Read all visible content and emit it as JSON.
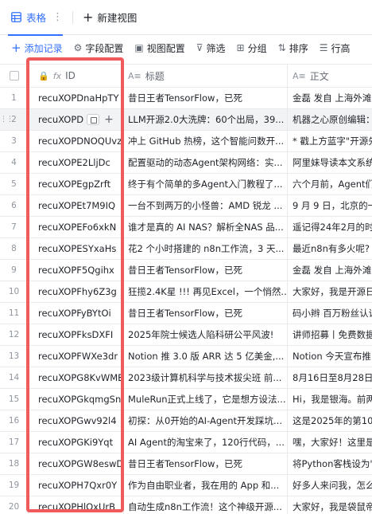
{
  "tabs": {
    "active_label": "表格",
    "more_glyph": "⋮",
    "new_view_label": "新建视图"
  },
  "toolbar": {
    "add_record": "添加记录",
    "field_config": "字段配置",
    "view_config": "视图配置",
    "filter": "筛选",
    "group": "分组",
    "sort": "排序",
    "row_height": "行高"
  },
  "columns": {
    "id": "ID",
    "title": "标题",
    "body": "正文"
  },
  "icons": {
    "table": "table-grid-icon",
    "lock": "lock-icon",
    "formula": "formula-icon",
    "text": "text-field-icon"
  },
  "colors": {
    "accent": "#3370ff",
    "highlight": "#f05a5a"
  },
  "rows": [
    {
      "num": "1",
      "id": "recuXOPDnaHpTY",
      "title": "昔日王者TensorFlow，已死",
      "body": "金磊 发自 上海外滩"
    },
    {
      "num": "2",
      "id": "recuXOPD",
      "title": "LLM开源2.0大洗牌：60个出局，39...",
      "body": "机器之心原创编辑："
    },
    {
      "num": "3",
      "id": "recuXOPDNOQUvz",
      "title": "冲上 GitHub 热榜，这个智能问数开...",
      "body": "* 戳上方蓝字\"开源先"
    },
    {
      "num": "4",
      "id": "recuXOPE2LljDc",
      "title": "配置驱动的动态Agent架构网络：实...",
      "body": "阿里妹导读本文系统"
    },
    {
      "num": "5",
      "id": "recuXOPEgpZrft",
      "title": "终于有个简单的多Agent入门教程了...",
      "body": "六个月前，Agent们"
    },
    {
      "num": "6",
      "id": "recuXOPEt7M9IQ",
      "title": "一台不到两万的小怪兽：AMD 锐龙 ...",
      "body": "9 月 9 日，北京的一"
    },
    {
      "num": "7",
      "id": "recuXOPEFo6xkN",
      "title": "谁才是真的 AI NAS？解析全NAS 品...",
      "body": "遥记得24年2月的时"
    },
    {
      "num": "8",
      "id": "recuXOPESYxaHs",
      "title": "花2 个小时搭建的 n8n工作流，3 天...",
      "body": "最近n8n有多火呢?"
    },
    {
      "num": "9",
      "id": "recuXOPF5Qgihx",
      "title": "昔日王者TensorFlow，已死",
      "body": "金磊 发自 上海外滩"
    },
    {
      "num": "10",
      "id": "recuXOPFhy6Z3g",
      "title": "狂揽2.4K星 !!! 再见Excel，一个悄然...",
      "body": "大家好，我是开源日"
    },
    {
      "num": "11",
      "id": "recuXOPFyBYtOi",
      "title": "昔日王者TensorFlow，已死",
      "body": "码小辫 百万粉丝认证"
    },
    {
      "num": "12",
      "id": "recuXOPFksDXFI",
      "title": "2025年院士候选人陷科研公平风波!",
      "body": "讲师招募丨免费数据"
    },
    {
      "num": "13",
      "id": "recuXOPFWXe3dr",
      "title": "Notion 推 3.0 版 ARR 达 5 亿美金,...",
      "body": "Notion 今天宣布推出"
    },
    {
      "num": "14",
      "id": "recuXOPG8KvWME",
      "title": "2023级计算机科学与技术拔尖班 前...",
      "body": "8月16日至8月28日"
    },
    {
      "num": "15",
      "id": "recuXOPGkqmgSn",
      "title": "MuleRun正式上线了，它是想方设法...",
      "body": "Hi，我是银海。前两"
    },
    {
      "num": "16",
      "id": "recuXOPGwv92l4",
      "title": "初探：从0开始的AI-Agent开发踩坑...",
      "body": "这是2025年的第103"
    },
    {
      "num": "17",
      "id": "recuXOPGKi9Yqt",
      "title": "AI Agent的淘宝来了，120行代码，...",
      "body": "嘿，大家好！这里是"
    },
    {
      "num": "18",
      "id": "recuXOPGW8eswD",
      "title": "昔日王者TensorFlow，已死",
      "body": "将Python客栈设为\"星"
    },
    {
      "num": "19",
      "id": "recuXOPH7Qxr0Y",
      "title": "作为自由职业者，我在用的 App 和...",
      "body": "好多人来问我，怎么"
    },
    {
      "num": "20",
      "id": "recuXOPHlOxUrB",
      "title": "自动生成n8n工作流！这个神级开源...",
      "body": "大家好，我是袋鼠帝"
    }
  ]
}
